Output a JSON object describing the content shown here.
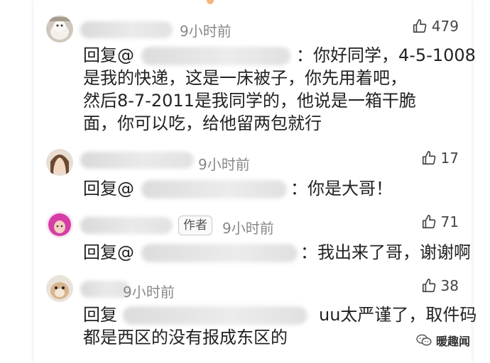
{
  "comments": [
    {
      "time": "9小时前",
      "likes": "479",
      "reply_label": "回复@",
      "reply_first": "：你好同学，4-5-1008",
      "reply_lines": [
        "是我的快递，这是一床被子，你先用着吧，",
        "然后8-7-2011是我同学的，他说是一箱干脆",
        "面，你可以吃，给他留两包就行"
      ]
    },
    {
      "time": "9小时前",
      "likes": "17",
      "reply_label": "回复@",
      "reply_first": "：你是大哥！",
      "reply_lines": []
    },
    {
      "author_tag": "作者",
      "time": "9小时前",
      "likes": "71",
      "reply_label": "回复@",
      "reply_first": "：我出来了哥，谢谢啊",
      "reply_lines": []
    },
    {
      "time": "9小时前",
      "likes": "38",
      "reply_label": "回复",
      "reply_first": "uu太严谨了，取件码",
      "reply_lines": [
        "都是西区的没有报成东区的"
      ]
    }
  ],
  "watermark": "暖趣闻",
  "icons": {
    "like": "thumbs-up-icon",
    "watermark": "wechat-icon"
  },
  "colors": {
    "time": "#888888",
    "text": "#222222",
    "background": "#ffffff"
  }
}
